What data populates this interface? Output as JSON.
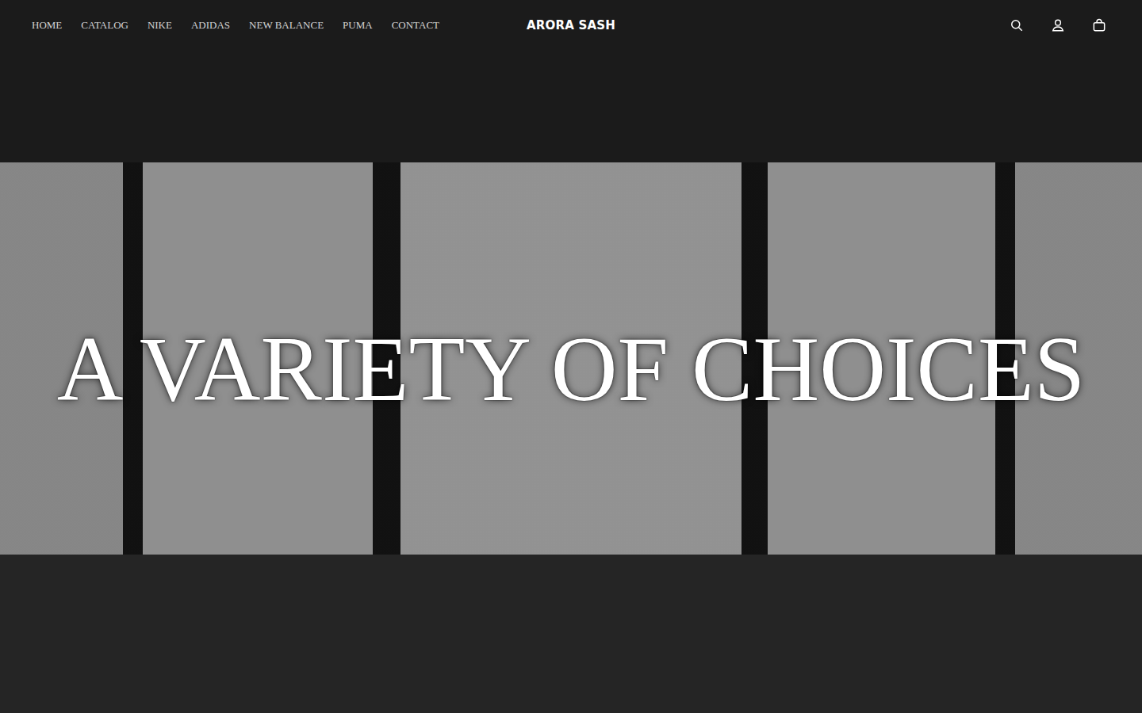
{
  "nav": {
    "items": [
      {
        "label": "HOME"
      },
      {
        "label": "CATALOG"
      },
      {
        "label": "NIKE"
      },
      {
        "label": "ADIDAS"
      },
      {
        "label": "NEW BALANCE"
      },
      {
        "label": "PUMA"
      },
      {
        "label": "CONTACT"
      }
    ]
  },
  "brand": "ARORA SASH",
  "hero": {
    "headline": "A VARIETY OF CHOICES"
  }
}
